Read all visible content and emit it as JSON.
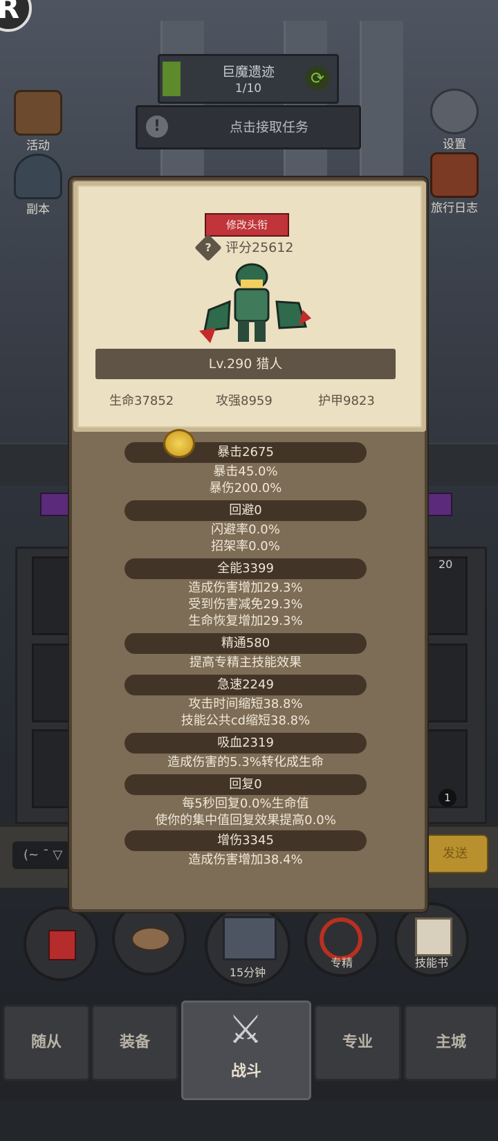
{
  "top": {
    "corner_badge": "R",
    "quest": {
      "title": "巨魔遗迹",
      "progress": "1/10",
      "progress_fraction": 0.1
    },
    "accept_task": {
      "label": "点击接取任务",
      "icon": "exclamation-icon"
    }
  },
  "side_left": [
    {
      "label": "活动",
      "icon": "activity-board-icon"
    },
    {
      "label": "副本",
      "icon": "dungeon-portal-icon"
    }
  ],
  "side_right": [
    {
      "label": "设置",
      "icon": "gear-icon"
    },
    {
      "label": "旅行日志",
      "icon": "journal-icon"
    }
  ],
  "chat": {
    "input_text": "(~ ¯ ▽",
    "send_label": "发送"
  },
  "skill_slots": {
    "badge_top": "20",
    "badge_bottom": "1"
  },
  "action_buttons": [
    {
      "label": "",
      "icon": "potion-icon"
    },
    {
      "label": "",
      "icon": "bread-icon"
    },
    {
      "label": "15分钟",
      "icon": "treasure-chest-icon"
    },
    {
      "label": "专精",
      "icon": "specialization-icon"
    },
    {
      "label": "技能书",
      "icon": "skill-book-icon"
    }
  ],
  "nav": {
    "tabs": [
      "随从",
      "装备",
      "战斗",
      "专业",
      "主城"
    ],
    "active": "战斗"
  },
  "character": {
    "edit_title_label": "修改头衔",
    "score_label": "评分25612",
    "name_level": "Lv.290 猎人",
    "hp": "生命37852",
    "attack": "攻强8959",
    "armor": "护甲9823"
  },
  "stats": [
    {
      "header": "暴击2675",
      "lines": [
        "暴击45.0%",
        "暴伤200.0%"
      ]
    },
    {
      "header": "回避0",
      "lines": [
        "闪避率0.0%",
        "招架率0.0%"
      ]
    },
    {
      "header": "全能3399",
      "lines": [
        "造成伤害增加29.3%",
        "受到伤害减免29.3%",
        "生命恢复增加29.3%"
      ]
    },
    {
      "header": "精通580",
      "lines": [
        "提高专精主技能效果"
      ]
    },
    {
      "header": "急速2249",
      "lines": [
        "攻击时间缩短38.8%",
        "技能公共cd缩短38.8%"
      ]
    },
    {
      "header": "吸血2319",
      "lines": [
        "造成伤害的5.3%转化成生命"
      ]
    },
    {
      "header": "回复0",
      "lines": [
        "每5秒回复0.0%生命值",
        "使你的集中值回复效果提高0.0%"
      ]
    },
    {
      "header": "增伤3345",
      "lines": [
        "造成伤害增加38.4%"
      ]
    }
  ],
  "colors": {
    "panel_bg": "#7d6c56",
    "card_bg": "#ece0c3",
    "stat_header_bg": "#423528",
    "edit_button": "#c0343a",
    "quest_fill": "#5d8a2a"
  }
}
